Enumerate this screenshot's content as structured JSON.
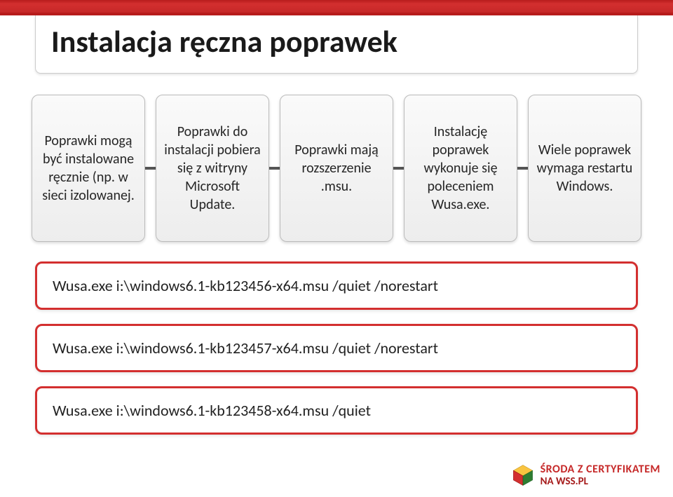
{
  "title": "Instalacja ręczna poprawek",
  "flow": [
    "Poprawki mogą być instalowane ręcznie (np. w sieci izolowanej.",
    "Poprawki do instalacji pobiera się z witryny Microsoft Update.",
    "Poprawki mają rozszerzenie .msu.",
    "Instalację poprawek wykonuje się poleceniem Wusa.exe.",
    "Wiele poprawek wymaga restartu Windows."
  ],
  "commands": [
    "Wusa.exe i:\\windows6.1-kb123456-x64.msu /quiet /norestart",
    "Wusa.exe i:\\windows6.1-kb123457-x64.msu /quiet /norestart",
    "Wusa.exe i:\\windows6.1-kb123458-x64.msu /quiet"
  ],
  "footer": {
    "line1": "ŚRODA Z CERTYFIKATEM",
    "line2": "NA WSS.PL"
  }
}
